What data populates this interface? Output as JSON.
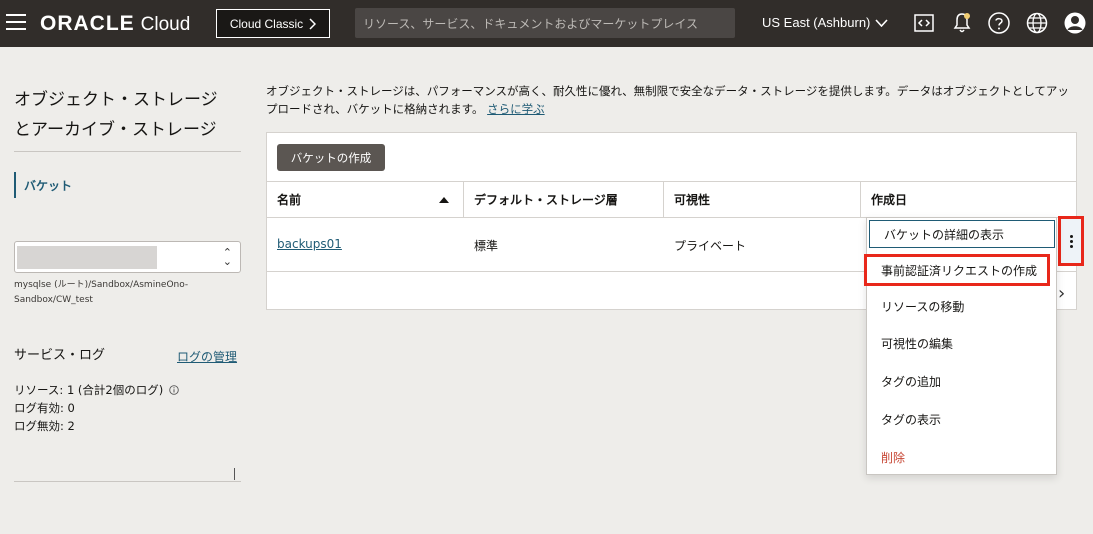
{
  "header": {
    "brand": "ORACLE",
    "product": "Cloud",
    "classic_button": "Cloud Classic",
    "search_placeholder": "リソース、サービス、ドキュメントおよびマーケットプレイス",
    "region": "US East (Ashburn)",
    "icons": [
      "code-editor-icon",
      "bell-icon",
      "help-icon",
      "globe-icon",
      "user-icon"
    ]
  },
  "sidebar": {
    "title_line1": "オブジェクト・ストレージ",
    "title_line2": "とアーカイブ・ストレージ",
    "nav_items": [
      {
        "label": "バケット"
      }
    ],
    "compartment_path": "mysqlse (ルート)/Sandbox/AsmineOno-Sandbox/CW_test",
    "service_logs": {
      "title": "サービス・ログ",
      "manage_link": "ログの管理",
      "resources": "リソース: 1 (合計2個のログ)",
      "logs_enabled": "ログ有効:  0",
      "logs_disabled": "ログ無効:  2"
    }
  },
  "main": {
    "description": "オブジェクト・ストレージは、パフォーマンスが高く、耐久性に優れ、無制限で安全なデータ・ストレージを提供します。データはオブジェクトとしてアップロードされ、バケットに格納されます。",
    "learn_more": "さらに学ぶ",
    "create_button": "バケットの作成",
    "columns": [
      "名前",
      "デフォルト・ストレージ層",
      "可視性",
      "作成日"
    ],
    "rows": [
      {
        "name": "backups01",
        "tier": "標準",
        "visibility": "プライベート"
      }
    ]
  },
  "action_menu": {
    "items": [
      {
        "label": "バケットの詳細の表示"
      },
      {
        "label": "事前認証済リクエストの作成"
      },
      {
        "label": "リソースの移動"
      },
      {
        "label": "可視性の編集"
      },
      {
        "label": "タグの追加"
      },
      {
        "label": "タグの表示"
      },
      {
        "label": "削除"
      }
    ]
  },
  "colors": {
    "header_bg": "#312d2a",
    "link": "#1f5b75",
    "highlight_box": "#e8271a",
    "danger": "#c74634"
  }
}
